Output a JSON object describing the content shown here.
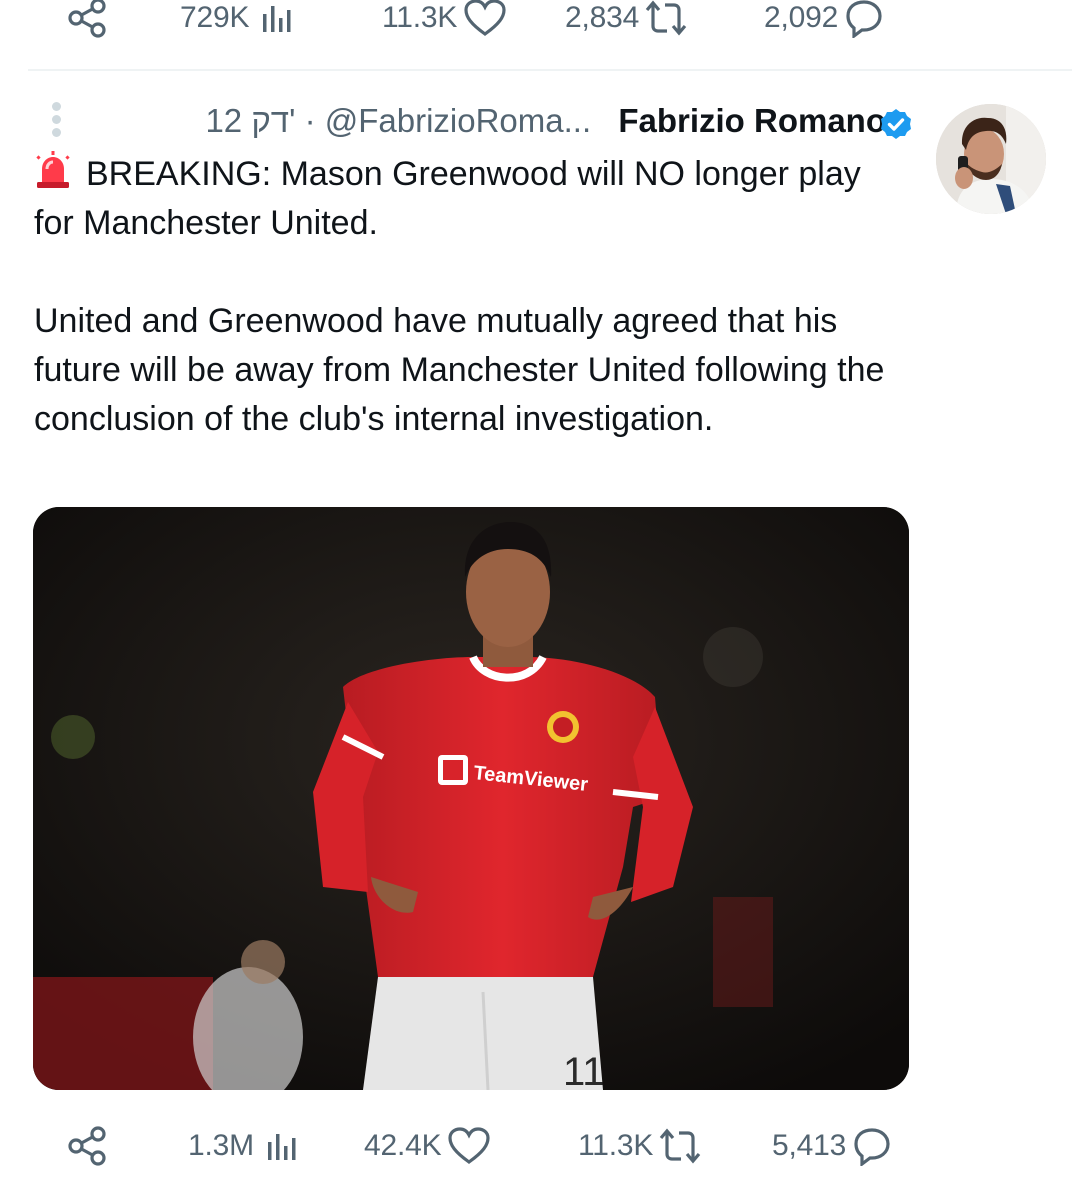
{
  "top_actions": {
    "views": "729K",
    "likes": "11.3K",
    "reposts": "2,834",
    "replies": "2,092"
  },
  "tweet": {
    "time_text": "12 דק'",
    "separator": "·",
    "handle": "@FabrizioRoma...",
    "display_name": "Fabrizio Romano",
    "text_line1": "BREAKING: Mason Greenwood will NO longer play for Manchester United.",
    "text_para2": "United and Greenwood have mutually agreed that his future will be away from Manchester United following the conclusion of the club's internal investigation.",
    "image": {
      "jersey_sponsor": "TeamViewer",
      "shorts_number": "11"
    }
  },
  "bottom_actions": {
    "views": "1.3M",
    "likes": "42.4K",
    "reposts": "11.3K",
    "replies": "5,413"
  },
  "colors": {
    "text_primary": "#0f1419",
    "text_secondary": "#536471",
    "verified_blue": "#1d9bf0",
    "divider": "#eff3f4",
    "jersey_red": "#d8232a"
  },
  "icons": [
    "share-icon",
    "views-icon",
    "heart-icon",
    "repost-icon",
    "reply-icon",
    "more-icon",
    "verified-badge-icon",
    "siren-emoji-icon"
  ]
}
